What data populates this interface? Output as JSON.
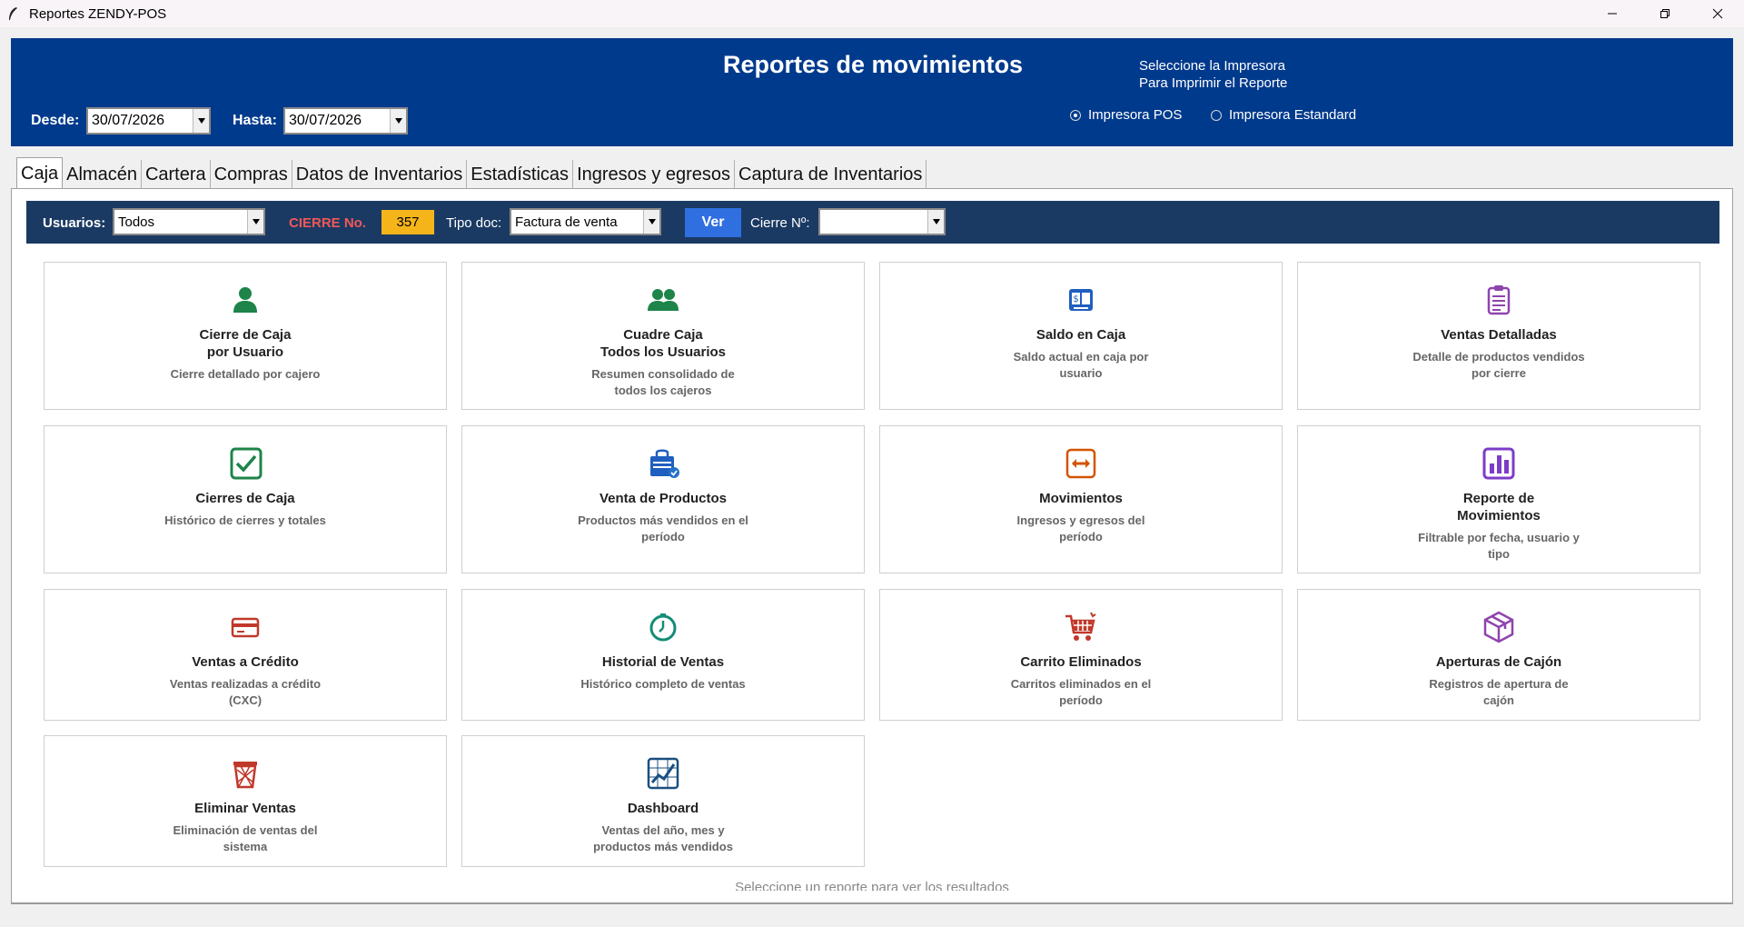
{
  "window": {
    "title": "Reportes ZENDY-POS"
  },
  "header": {
    "title": "Reportes de movimientos",
    "printer_prompt_line1": "Seleccione la Impresora",
    "printer_prompt_line2": "Para Imprimir el Reporte",
    "printer_pos": "Impresora POS",
    "printer_std": "Impresora Estandard",
    "selected_printer": "pos",
    "desde_label": "Desde:",
    "desde_value": "30/07/2026",
    "hasta_label": "Hasta:",
    "hasta_value": "30/07/2026",
    "bg_color": "#003a8c"
  },
  "tabs": [
    {
      "label": "Caja",
      "active": true
    },
    {
      "label": "Almacén"
    },
    {
      "label": "Cartera"
    },
    {
      "label": "Compras"
    },
    {
      "label": "Datos de Inventarios"
    },
    {
      "label": "Estadísticas"
    },
    {
      "label": "Ingresos y egresos"
    },
    {
      "label": "Captura de Inventarios"
    }
  ],
  "filters": {
    "usuarios_label": "Usuarios:",
    "usuarios_value": "Todos",
    "cierre_label": "CIERRE No.",
    "cierre_value": "357",
    "tipo_doc_label": "Tipo doc:",
    "tipo_doc_value": "Factura de venta",
    "ver_label": "Ver",
    "cierre_n_label": "Cierre Nº:",
    "cierre_n_value": ""
  },
  "cards": [
    {
      "name": "cierre-caja-usuario",
      "icon": "user-icon",
      "color": "#1e8449",
      "title1": "Cierre de Caja",
      "title2": "por Usuario",
      "desc": "Cierre detallado por cajero"
    },
    {
      "name": "cuadre-caja",
      "icon": "users-icon",
      "color": "#1e8449",
      "title1": "Cuadre Caja",
      "title2": "Todos los Usuarios",
      "desc": "Resumen consolidado de todos los cajeros"
    },
    {
      "name": "saldo-caja",
      "icon": "cash-register-icon",
      "color": "#1f5fbf",
      "title1": "Saldo en Caja",
      "title2": "",
      "desc": "Saldo actual en caja por usuario"
    },
    {
      "name": "ventas-detalladas",
      "icon": "clipboard-icon",
      "color": "#8e44ad",
      "title1": "Ventas Detalladas",
      "title2": "",
      "desc": "Detalle de productos vendidos por cierre"
    },
    {
      "name": "cierres-caja",
      "icon": "checkbox-icon",
      "color": "#1e8449",
      "title1": "Cierres de Caja",
      "title2": "",
      "desc": "Histórico de cierres y totales"
    },
    {
      "name": "venta-productos",
      "icon": "shopping-bag-icon",
      "color": "#1f5fbf",
      "title1": "Venta de Productos",
      "title2": "",
      "desc": "Productos más vendidos en el período"
    },
    {
      "name": "movimientos",
      "icon": "arrows-icon",
      "color": "#d35400",
      "title1": "Movimientos",
      "title2": "",
      "desc": "Ingresos y egresos del período"
    },
    {
      "name": "reporte-movimientos",
      "icon": "bar-chart-icon",
      "color": "#7d3cc8",
      "title1": "Reporte de",
      "title2": "Movimientos",
      "desc": "Filtrable por fecha, usuario y tipo"
    },
    {
      "name": "ventas-credito",
      "icon": "credit-card-icon",
      "color": "#c0392b",
      "title1": "Ventas a Crédito",
      "title2": "",
      "desc": "Ventas realizadas a crédito (CXC)"
    },
    {
      "name": "historial-ventas",
      "icon": "clock-icon",
      "color": "#138d75",
      "title1": "Historial de Ventas",
      "title2": "",
      "desc": "Histórico completo de ventas"
    },
    {
      "name": "carrito-eliminados",
      "icon": "cart-icon",
      "color": "#c0392b",
      "title1": "Carrito Eliminados",
      "title2": "",
      "desc": "Carritos eliminados en el período"
    },
    {
      "name": "aperturas-cajon",
      "icon": "box-icon",
      "color": "#8e44ad",
      "title1": "Aperturas de Cajón",
      "title2": "",
      "desc": "Registros de apertura de cajón"
    },
    {
      "name": "eliminar-ventas",
      "icon": "trash-icon",
      "color": "#c0392b",
      "title1": "Eliminar Ventas",
      "title2": "",
      "desc": "Eliminación de ventas del sistema"
    },
    {
      "name": "dashboard",
      "icon": "line-chart-icon",
      "color": "#1a4f80",
      "title1": "Dashboard",
      "title2": "",
      "desc": "Ventas del año, mes y productos más vendidos"
    }
  ],
  "hint": "Seleccione un reporte para ver los resultados"
}
